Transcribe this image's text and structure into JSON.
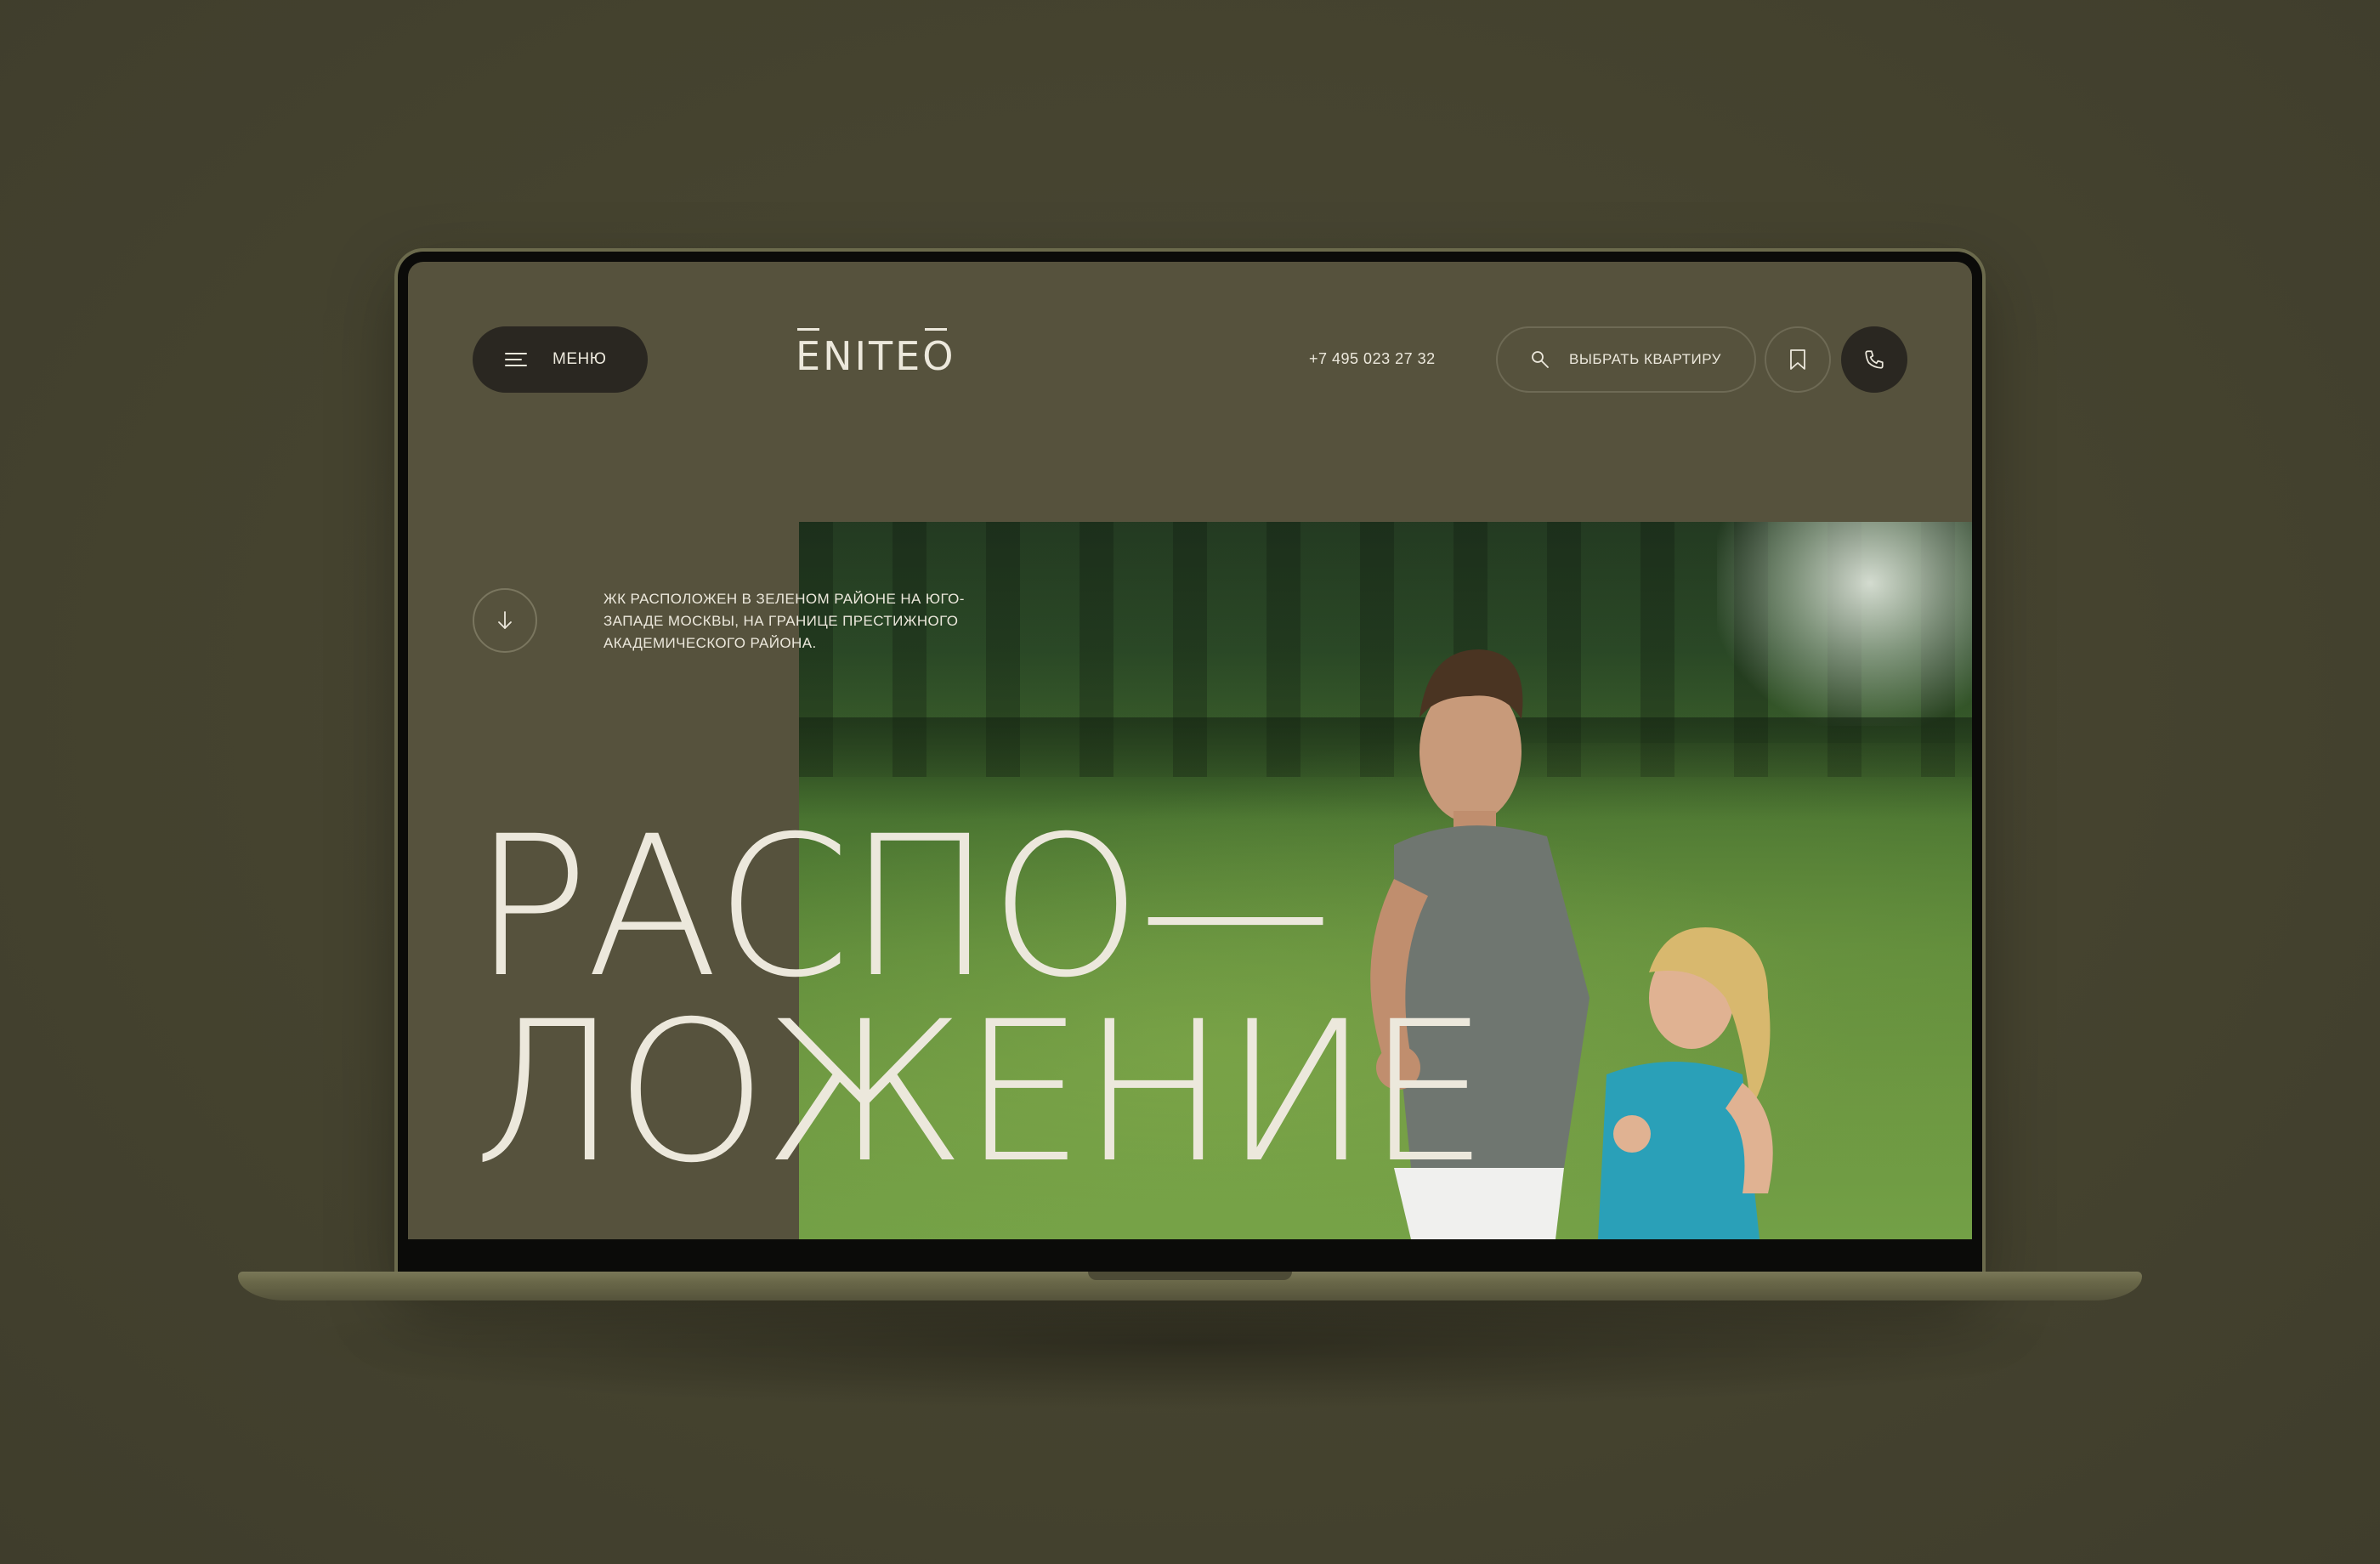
{
  "header": {
    "menu_label": "МЕНЮ",
    "logo_text": "ENITEO",
    "phone": "+7 495 023 27 32",
    "pick_apartment_label": "ВЫБРАТЬ КВАРТИРУ"
  },
  "hero": {
    "intro_text": "ЖК РАСПОЛОЖЕН В ЗЕЛЕНОМ РАЙОНЕ НА ЮГО-ЗАПАДЕ МОСКВЫ, НА ГРАНИЦЕ ПРЕСТИЖНОГО АКАДЕМИЧЕСКОГО РАЙОНА.",
    "headline_line1": "РАСПО—",
    "headline_line2": "ЛОЖЕНИЕ"
  },
  "colors": {
    "background": "#484634",
    "screen": "#56523d",
    "dark_button": "#2a2721",
    "text": "#ece8dc"
  },
  "icons": {
    "menu": "hamburger-icon",
    "search": "search-icon",
    "bookmark": "bookmark-icon",
    "phone": "phone-icon",
    "scroll": "arrow-down-icon"
  }
}
